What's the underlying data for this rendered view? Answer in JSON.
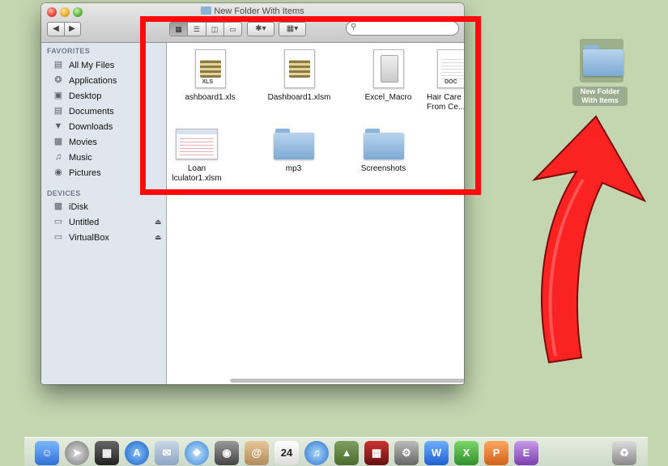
{
  "window": {
    "title": "New Folder With Items",
    "nav_back": "◀",
    "nav_forward": "▶",
    "view_icon": "icon-view",
    "view_list": "list-view",
    "view_columns": "column-view",
    "view_coverflow": "coverflow-view",
    "action_label": "✱▾",
    "arrange_label": "▦▾"
  },
  "sidebar": {
    "favorites_header": "FAVORITES",
    "favorites": [
      {
        "label": "All My Files",
        "icon": "files-icon"
      },
      {
        "label": "Applications",
        "icon": "applications-icon"
      },
      {
        "label": "Desktop",
        "icon": "desktop-icon"
      },
      {
        "label": "Documents",
        "icon": "documents-icon"
      },
      {
        "label": "Downloads",
        "icon": "downloads-icon"
      },
      {
        "label": "Movies",
        "icon": "movies-icon"
      },
      {
        "label": "Music",
        "icon": "music-icon"
      },
      {
        "label": "Pictures",
        "icon": "pictures-icon"
      }
    ],
    "devices_header": "DEVICES",
    "devices": [
      {
        "label": "iDisk",
        "icon": "disk-icon"
      },
      {
        "label": "Untitled",
        "icon": "drive-icon",
        "eject": "⏏"
      },
      {
        "label": "VirtualBox",
        "icon": "drive-icon",
        "eject": "⏏"
      }
    ]
  },
  "files": [
    {
      "name": "ashboard1.xls",
      "type": "xls",
      "tag": "XLS"
    },
    {
      "name": "Dashboard1.xlsm",
      "type": "xls"
    },
    {
      "name": "Excel_Macro",
      "type": "script"
    },
    {
      "name": "Hair Care",
      "name2": "From Ce...na",
      "type": "doc",
      "tag": "DOC"
    },
    {
      "name": "Loan",
      "name2": "lculator1.xlsm",
      "type": "sheet"
    },
    {
      "name": "mp3",
      "type": "folder"
    },
    {
      "name": "Screenshots",
      "type": "folder"
    }
  ],
  "desktop": {
    "folder_label_line1": "New Folder",
    "folder_label_line2": "With Items"
  },
  "dock": {
    "calendar_day": "24"
  },
  "colors": {
    "highlight": "#ff0a0a",
    "desktop_bg": "#c3d6b0"
  }
}
